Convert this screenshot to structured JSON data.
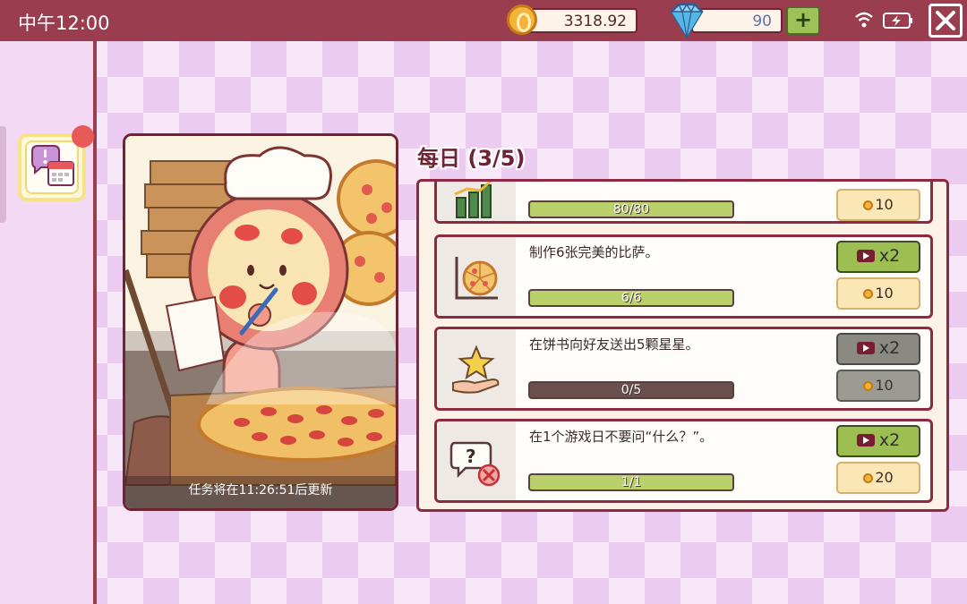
{
  "status_bar": {
    "time": "中午12:00",
    "coins": "3318.92",
    "gems": "90",
    "add_label": "+"
  },
  "colors": {
    "topbar": "#9a3d4f",
    "progress_fill": "#b9d06b",
    "button_green": "#9dbf51",
    "button_disabled": "#8a8a82"
  },
  "picture": {
    "caption": "任务将在11:26:51后更新"
  },
  "daily": {
    "title": "每日 (3/5)"
  },
  "tasks": [
    {
      "icon": "bar-chart-icon",
      "description": "",
      "progress_text": "80/80",
      "progress": 1.0,
      "reward": "10",
      "has_ad": false
    },
    {
      "icon": "pizza-measure-icon",
      "description": "制作6张完美的比萨。",
      "progress_text": "6/6",
      "progress": 1.0,
      "ad_label": "x2",
      "reward": "10",
      "has_ad": true,
      "enabled": true
    },
    {
      "icon": "star-hand-icon",
      "description": "在饼书向好友送出5颗星星。",
      "progress_text": "0/5",
      "progress": 0.0,
      "ad_label": "x2",
      "reward": "10",
      "has_ad": true,
      "enabled": false
    },
    {
      "icon": "question-ban-icon",
      "description": "在1个游戏日不要问“什么？”。",
      "progress_text": "1/1",
      "progress": 1.0,
      "ad_label": "x2",
      "reward": "20",
      "has_ad": true,
      "enabled": true
    }
  ]
}
